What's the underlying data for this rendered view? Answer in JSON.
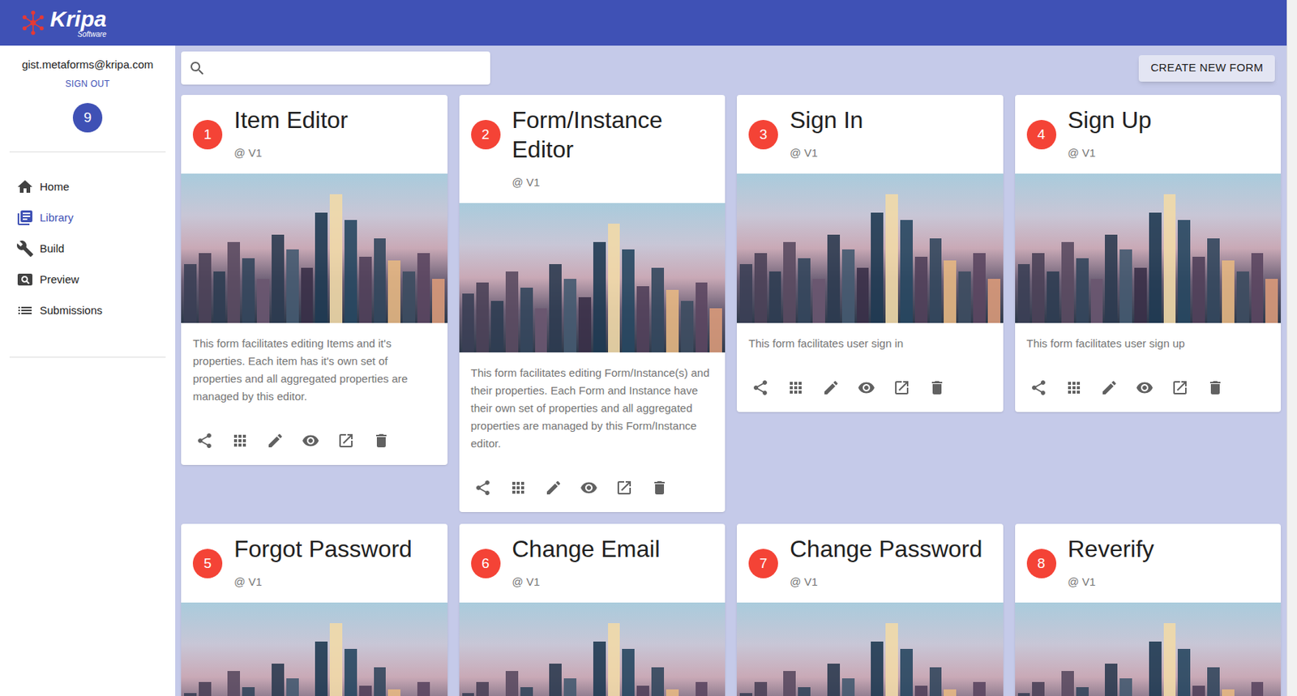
{
  "app": {
    "logo_title": "Kripa",
    "logo_subtitle": "Software"
  },
  "user": {
    "email": "gist.metaforms@kripa.com",
    "sign_out": "SIGN OUT",
    "badge": "9"
  },
  "sidebar": {
    "items": [
      {
        "label": "Home",
        "selected": false
      },
      {
        "label": "Library",
        "selected": true
      },
      {
        "label": "Build",
        "selected": false
      },
      {
        "label": "Preview",
        "selected": false
      },
      {
        "label": "Submissions",
        "selected": false
      }
    ]
  },
  "create_button": "CREATE NEW FORM",
  "cards": [
    {
      "number": "1",
      "title": "Item Editor",
      "version": "@ V1",
      "description": "This form facilitates editing Items and it's properties. Each item has it's own set of properties and all aggregated properties are managed by this editor."
    },
    {
      "number": "2",
      "title": "Form/Instance Editor",
      "version": "@ V1",
      "description": "This form facilitates editing Form/Instance(s) and their properties. Each Form and Instance have their own set of properties and all aggregated properties are managed by this Form/Instance editor."
    },
    {
      "number": "3",
      "title": "Sign In",
      "version": "@ V1",
      "description": "This form facilitates user sign in"
    },
    {
      "number": "4",
      "title": "Sign Up",
      "version": "@ V1",
      "description": "This form facilitates user sign up"
    },
    {
      "number": "5",
      "title": "Forgot Password",
      "version": "@ V1"
    },
    {
      "number": "6",
      "title": "Change Email",
      "version": "@ V1"
    },
    {
      "number": "7",
      "title": "Change Password",
      "version": "@ V1"
    },
    {
      "number": "8",
      "title": "Reverify",
      "version": "@ V1"
    }
  ]
}
